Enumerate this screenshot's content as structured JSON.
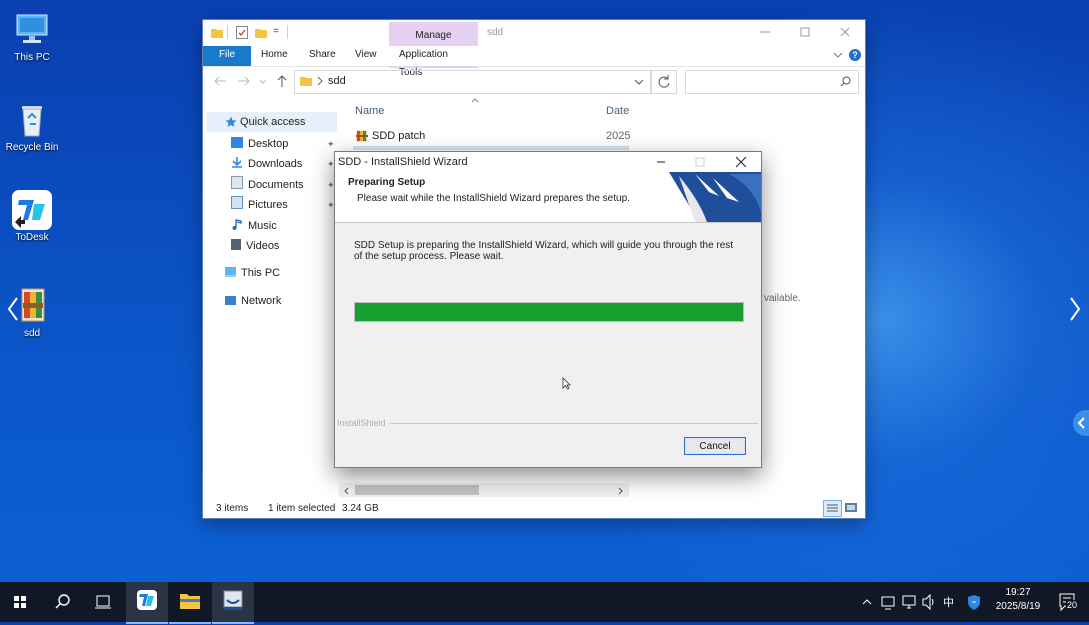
{
  "desktop": {
    "icons": [
      {
        "label": "This PC"
      },
      {
        "label": "Recycle Bin"
      },
      {
        "label": "ToDesk"
      },
      {
        "label": "sdd"
      }
    ]
  },
  "explorer": {
    "quick_toolbar_symbol": "=",
    "context_tab": "Manage",
    "title": "sdd",
    "ribbon_tabs": [
      "File",
      "Home",
      "Share",
      "View",
      "Application Tools"
    ],
    "address": {
      "path": "sdd"
    },
    "columns": {
      "name": "Name",
      "date": "Date"
    },
    "files": [
      {
        "name": "SDD patch",
        "date": "2025"
      }
    ],
    "partial_text": "vailable.",
    "nav": {
      "quick_access": "Quick access",
      "items": [
        "Desktop",
        "Downloads",
        "Documents",
        "Pictures",
        "Music",
        "Videos"
      ],
      "this_pc": "This PC",
      "network": "Network"
    },
    "status": {
      "items": "3 items",
      "selected": "1 item selected",
      "size": "3.24 GB"
    }
  },
  "dialog": {
    "title": "SDD - InstallShield Wizard",
    "heading": "Preparing Setup",
    "subheading": "Please wait while the InstallShield Wizard prepares the setup.",
    "body": "SDD Setup is preparing the InstallShield Wizard, which will guide you through the rest of the setup process. Please wait.",
    "progress": 1.0,
    "brand": "InstallShield",
    "cancel_label": "Cancel",
    "colors": {
      "progress": "#16a030"
    }
  },
  "taskbar": {
    "ime": "中",
    "time": "19:27",
    "date": "2025/8/19",
    "notifications": "20"
  }
}
